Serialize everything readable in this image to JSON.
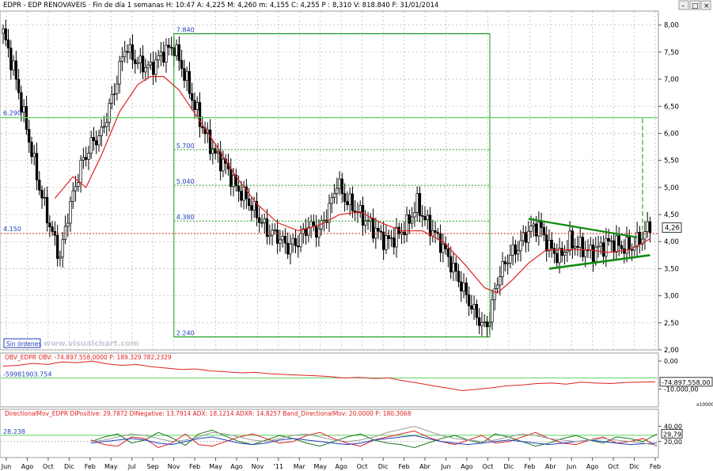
{
  "header": {
    "text": "EDPR - EDP RENOVAVEIS · Fin de día 1 semanas H: 10:47  A: 4,225  M: 4,260  m: 4,155  C: 4,255  P : 8,310  V: 818.840  F: 31/01/2014"
  },
  "window_controls": [
    {
      "name": "minimize",
      "glyph": "–"
    },
    {
      "name": "maximize",
      "glyph": "□"
    },
    {
      "name": "close",
      "glyph": "×"
    }
  ],
  "badges": {
    "sin_ordenes": "Sin órdenes",
    "watermark": "www.visualchart.com",
    "x10000": "x10000"
  },
  "colors": {
    "price": "#000000",
    "ma": "#e02020",
    "fib": "#1c9b1c",
    "hline": "#5ad35a",
    "support": "#e02020",
    "triangle": "#128a12",
    "obv": "#e02020",
    "label_blue": "#1f3fbf",
    "di_plus": "#1a7a1a",
    "di_minus": "#e02020",
    "adx": "#1f3fbf",
    "adxr": "#9a9a9a"
  },
  "chart_data": [
    {
      "type": "candlestick",
      "title": "EDPR - EDP RENOVAVEIS",
      "ylim": [
        2.0,
        8.2
      ],
      "yticks": [
        "8,00",
        "7,50",
        "7,00",
        "6,50",
        "6,00",
        "5,50",
        "5,00",
        "4,50",
        "4,00",
        "3,50",
        "3,00",
        "2,50",
        "2,00"
      ],
      "last_price_label": "4,26",
      "x_labels": [
        "Jun",
        "Ago",
        "Oct",
        "Dic",
        "Feb",
        "May",
        "Jul",
        "Sep",
        "Nov",
        "Feb",
        "May",
        "Ago",
        "Nov",
        "'11",
        "Mar",
        "May",
        "Ago",
        "Oct",
        "Dic",
        "Feb",
        "Abr",
        "Jun",
        "Ago",
        "Oct",
        "Dic",
        "Feb",
        "Abr",
        "Jun",
        "Ago",
        "Oct",
        "Dic",
        "Feb"
      ],
      "close_path": [
        [
          0,
          7.85
        ],
        [
          4,
          7.2
        ],
        [
          9,
          6.1
        ],
        [
          14,
          5.0
        ],
        [
          18,
          4.3
        ],
        [
          22,
          3.7
        ],
        [
          25,
          4.5
        ],
        [
          30,
          5.4
        ],
        [
          34,
          5.8
        ],
        [
          38,
          6.0
        ],
        [
          43,
          6.8
        ],
        [
          47,
          7.6
        ],
        [
          52,
          7.3
        ],
        [
          57,
          7.2
        ],
        [
          62,
          7.5
        ],
        [
          66,
          7.6
        ],
        [
          70,
          7.1
        ],
        [
          74,
          6.5
        ],
        [
          78,
          6.0
        ],
        [
          82,
          5.6
        ],
        [
          86,
          5.4
        ],
        [
          90,
          5.0
        ],
        [
          94,
          4.8
        ],
        [
          98,
          4.5
        ],
        [
          102,
          4.2
        ],
        [
          106,
          4.1
        ],
        [
          110,
          3.9
        ],
        [
          114,
          4.0
        ],
        [
          118,
          4.3
        ],
        [
          122,
          4.2
        ],
        [
          126,
          4.6
        ],
        [
          129,
          5.1
        ],
        [
          132,
          4.8
        ],
        [
          136,
          4.6
        ],
        [
          140,
          4.4
        ],
        [
          144,
          4.2
        ],
        [
          148,
          4.0
        ],
        [
          152,
          4.1
        ],
        [
          156,
          4.3
        ],
        [
          160,
          4.7
        ],
        [
          163,
          4.4
        ],
        [
          166,
          4.2
        ],
        [
          170,
          3.9
        ],
        [
          174,
          3.5
        ],
        [
          178,
          3.1
        ],
        [
          182,
          2.7
        ],
        [
          186,
          2.4
        ],
        [
          188,
          2.6
        ],
        [
          191,
          3.3
        ],
        [
          195,
          3.7
        ],
        [
          199,
          3.9
        ],
        [
          203,
          4.2
        ],
        [
          207,
          4.3
        ],
        [
          211,
          3.9
        ],
        [
          215,
          3.7
        ],
        [
          219,
          4.0
        ],
        [
          223,
          3.9
        ],
        [
          227,
          3.8
        ],
        [
          231,
          3.9
        ],
        [
          235,
          4.0
        ],
        [
          239,
          3.9
        ],
        [
          243,
          3.9
        ],
        [
          247,
          4.1
        ],
        [
          250,
          4.3
        ]
      ],
      "ma_path": [
        [
          20,
          4.8
        ],
        [
          27,
          5.2
        ],
        [
          32,
          5.0
        ],
        [
          38,
          5.6
        ],
        [
          45,
          6.4
        ],
        [
          52,
          6.9
        ],
        [
          57,
          7.05
        ],
        [
          62,
          7.05
        ],
        [
          68,
          6.8
        ],
        [
          75,
          6.3
        ],
        [
          82,
          5.8
        ],
        [
          90,
          5.2
        ],
        [
          98,
          4.7
        ],
        [
          106,
          4.35
        ],
        [
          114,
          4.2
        ],
        [
          122,
          4.3
        ],
        [
          130,
          4.5
        ],
        [
          138,
          4.55
        ],
        [
          146,
          4.35
        ],
        [
          154,
          4.2
        ],
        [
          162,
          4.2
        ],
        [
          170,
          4.0
        ],
        [
          178,
          3.6
        ],
        [
          186,
          3.15
        ],
        [
          191,
          3.05
        ],
        [
          197,
          3.3
        ],
        [
          203,
          3.6
        ],
        [
          210,
          3.85
        ],
        [
          218,
          3.85
        ],
        [
          226,
          3.85
        ],
        [
          234,
          3.8
        ],
        [
          242,
          3.85
        ],
        [
          250,
          4.05
        ]
      ],
      "fibonacci": {
        "high": 7.84,
        "low": 2.24,
        "levels": [
          {
            "label": "7.840",
            "value": 7.84
          },
          {
            "label": "5.700",
            "value": 5.7
          },
          {
            "label": "5.040",
            "value": 5.04
          },
          {
            "label": "4.380",
            "value": 4.38
          },
          {
            "label": "2.240",
            "value": 2.24
          }
        ]
      },
      "horizontal_lines": [
        {
          "label": "6.290",
          "value": 6.29
        },
        {
          "label": "4.150",
          "value": 4.15
        }
      ],
      "triangle": {
        "upper": [
          [
            203,
            4.42
          ],
          [
            245,
            4.08
          ]
        ],
        "lower": [
          [
            211,
            3.5
          ],
          [
            250,
            3.75
          ]
        ]
      },
      "target_projection": {
        "from": 4.08,
        "to": 6.29
      }
    },
    {
      "type": "line",
      "title": "OBV_EDPR  OBV: -74.897.558,0000  P: 189.329.782,2329",
      "series_name": "OBV",
      "ylim": [
        -160,
        20
      ],
      "yticks": [
        "0,00",
        "-10.000,00"
      ],
      "scale_label": "x10000",
      "last_value_label": "-74.897.558,00",
      "reference_line": {
        "label": "-59981903.754",
        "value": -59.98
      },
      "values": [
        -18,
        -15,
        -8,
        -12,
        -3,
        -6,
        0,
        -10,
        -15,
        -12,
        -20,
        -25,
        -30,
        -28,
        -35,
        -38,
        -42,
        -40,
        -45,
        -48,
        -50,
        -52,
        -55,
        -60,
        -58,
        -62,
        -60,
        -70,
        -78,
        -88,
        -96,
        -105,
        -100,
        -95,
        -88,
        -85,
        -80,
        -78,
        -82,
        -75,
        -78,
        -80,
        -76,
        -75,
        -74
      ]
    },
    {
      "type": "line",
      "title": "DirectionalMov_EDPR  DIPositive: 29,7872  DINegative: 13,7914  ADX: 18,1214  ADXR: 14,8257  Band_DirectionalMov: 20,0000  P: 180,3068",
      "ylim": [
        0,
        50
      ],
      "yticks": [
        "40,00",
        "20,00"
      ],
      "reference_line": {
        "label": "28.238",
        "value": 28.238
      },
      "band_value": 20,
      "last_value_label": "29,79",
      "series": [
        {
          "name": "DIPositive",
          "values": [
            20,
            26,
            30,
            18,
            22,
            32,
            25,
            15,
            30,
            35,
            27,
            20,
            16,
            22,
            28,
            24,
            18,
            14,
            20,
            26,
            30,
            22,
            18,
            16,
            12,
            18,
            24,
            28,
            22,
            18,
            30,
            26,
            20,
            14,
            18,
            24,
            28,
            22,
            18,
            26,
            24,
            20,
            30
          ]
        },
        {
          "name": "DINegative",
          "values": [
            22,
            16,
            14,
            26,
            24,
            12,
            18,
            30,
            16,
            14,
            20,
            26,
            30,
            24,
            18,
            20,
            28,
            32,
            24,
            18,
            14,
            22,
            26,
            30,
            34,
            26,
            20,
            16,
            22,
            28,
            18,
            20,
            26,
            32,
            24,
            18,
            16,
            22,
            26,
            18,
            20,
            24,
            14
          ]
        },
        {
          "name": "ADX",
          "values": [
            18,
            20,
            22,
            24,
            22,
            18,
            16,
            20,
            24,
            26,
            22,
            18,
            16,
            18,
            22,
            24,
            22,
            20,
            18,
            16,
            18,
            22,
            24,
            26,
            28,
            24,
            20,
            18,
            16,
            18,
            20,
            22,
            20,
            18,
            16,
            18,
            20,
            22,
            20,
            18,
            16,
            17,
            18
          ]
        },
        {
          "name": "ADXR",
          "values": [
            20,
            22,
            26,
            30,
            28,
            24,
            20,
            22,
            26,
            32,
            30,
            26,
            22,
            20,
            24,
            28,
            30,
            26,
            22,
            20,
            22,
            26,
            32,
            36,
            40,
            34,
            28,
            24,
            22,
            20,
            22,
            26,
            30,
            28,
            24,
            22,
            20,
            22,
            24,
            22,
            20,
            18,
            15
          ]
        }
      ]
    }
  ]
}
